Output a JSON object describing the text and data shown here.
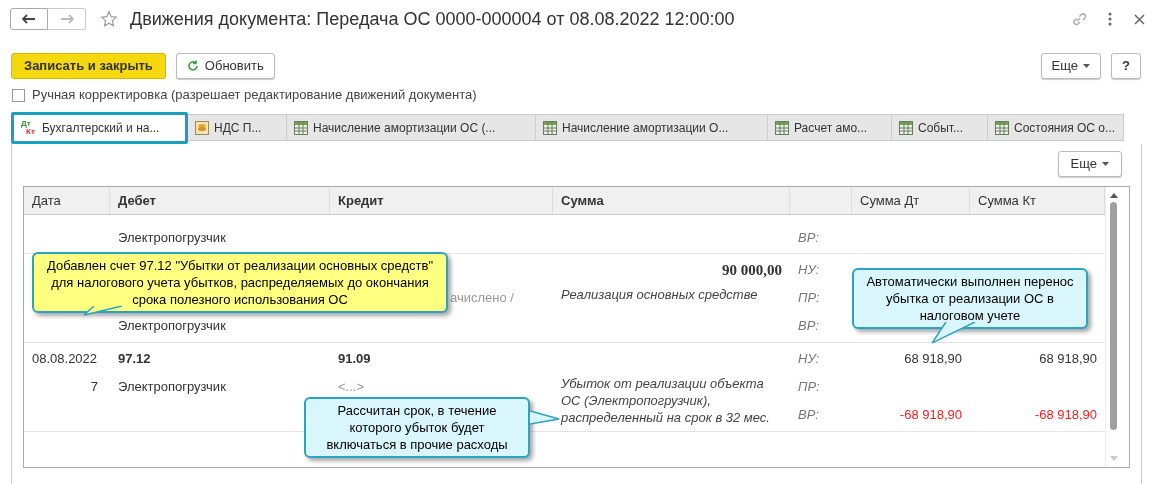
{
  "window": {
    "title": "Движения документа: Передача ОС 0000-000004 от 08.08.2022 12:00:00"
  },
  "toolbar": {
    "primary": "Записать и закрыть",
    "refresh": "Обновить",
    "more": "Еще",
    "help": "?"
  },
  "manual_edit": {
    "label": "Ручная корректировка (разрешает редактирование движений документа)",
    "checked": false
  },
  "tabs": [
    {
      "label": "Бухгалтерский и на...",
      "kind": "accounting",
      "icon_top": "Дт",
      "icon_bottom": "Кт",
      "selected": true
    },
    {
      "label": "НДС П...",
      "kind": "coins",
      "selected": false
    },
    {
      "label": "Начисление амортизации ОС (...",
      "kind": "table",
      "selected": false
    },
    {
      "label": "Начисление амортизации О...",
      "kind": "table",
      "selected": false
    },
    {
      "label": "Расчет амо...",
      "kind": "table",
      "selected": false
    },
    {
      "label": "Событ...",
      "kind": "table",
      "selected": false
    },
    {
      "label": "Состояния ОС о...",
      "kind": "table",
      "selected": false
    }
  ],
  "tab_more": "Еще",
  "table": {
    "columns": [
      {
        "label": "Дата",
        "bold": false
      },
      {
        "label": "Дебет",
        "bold": true
      },
      {
        "label": "Кредит",
        "bold": true
      },
      {
        "label": "Сумма",
        "bold": true
      },
      {},
      {
        "label": "Сумма Дт",
        "bold": false
      },
      {
        "label": "Сумма Кт",
        "bold": false
      }
    ],
    "rows": [
      {
        "lines": [
          {
            "kind": "subconto",
            "cells": [
              "",
              "Электропогрузчик",
              "",
              "",
              "ВР:",
              "",
              ""
            ]
          }
        ]
      },
      {
        "lines": [
          {
            "kind": "account",
            "cells": [
              "",
              "",
              "",
              "90 000,00",
              "НУ:",
              "",
              ""
            ]
          },
          {
            "kind": "subconto",
            "cells": [
              "",
              "",
              "ачислено /",
              "Реализация основных средстве",
              "ПР:",
              "",
              ""
            ]
          },
          {
            "kind": "subconto",
            "cells": [
              "",
              "Электропогрузчик",
              "",
              "",
              "ВР:",
              "",
              ""
            ]
          }
        ]
      },
      {
        "lines": [
          {
            "kind": "account",
            "cells": [
              "08.08.2022",
              "97.12",
              "91.09",
              "",
              "НУ:",
              "68 918,90",
              "68 918,90"
            ]
          },
          {
            "kind": "subconto",
            "cells": [
              "7",
              "Электропогрузчик",
              "<...>",
              "Убыток от реализации объекта ОС (Электропогрузчик), распределенный на срок в 32 мес.",
              "ПР:",
              "",
              ""
            ]
          },
          {
            "kind": "negative",
            "cells": [
              "",
              "",
              "",
              "",
              "ВР:",
              "-68 918,90",
              "-68 918,90"
            ]
          }
        ]
      }
    ]
  },
  "callouts": [
    {
      "text": "Добавлен счет 97.12 \"Убытки от реализации основных средств\" для налогового учета убытков, распределяемых до окончания срока полезного использования ОС",
      "color": "#ffff80"
    },
    {
      "text": "Автоматически выполнен перенос убытка от реализации ОС в налоговом учете",
      "color": "#d9f6fd"
    },
    {
      "text": "Рассчитан срок, в течение которого убыток будет включаться в прочие расходы",
      "color": "#d9f6fd"
    }
  ]
}
